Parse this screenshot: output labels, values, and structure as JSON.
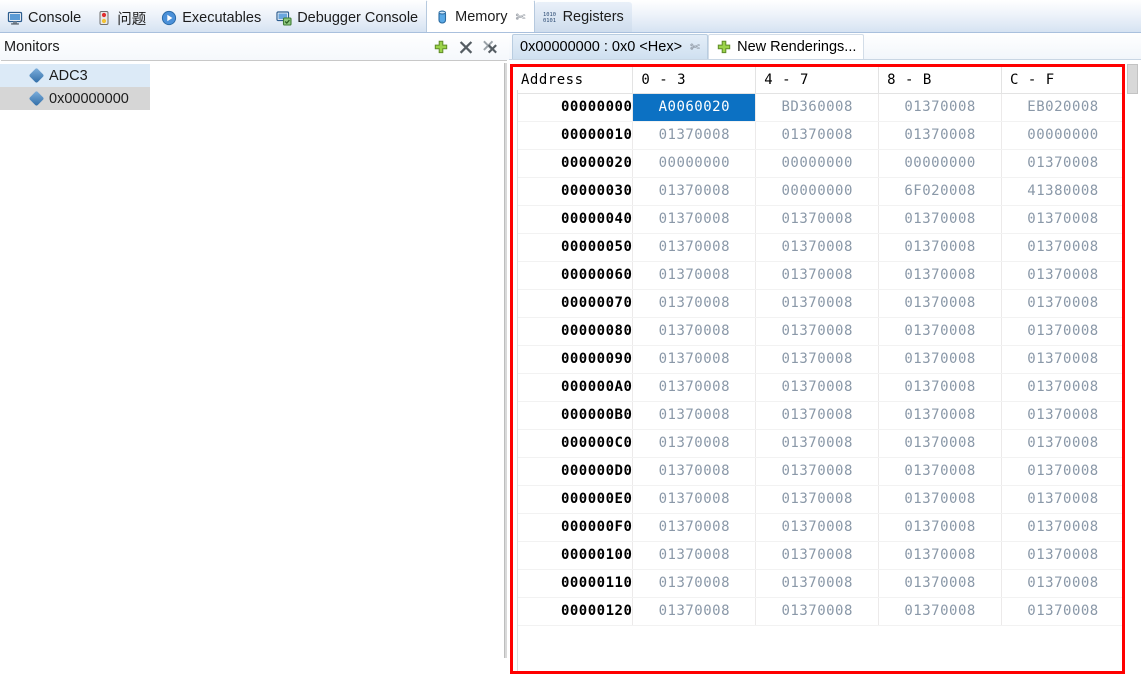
{
  "view_tabs": [
    {
      "label": "Console",
      "icon": "console-icon",
      "active": false
    },
    {
      "label": "问题",
      "icon": "problems-icon",
      "active": false
    },
    {
      "label": "Executables",
      "icon": "executables-icon",
      "active": false
    },
    {
      "label": "Debugger Console",
      "icon": "debugger-console-icon",
      "active": false
    },
    {
      "label": "Memory",
      "icon": "memory-icon",
      "active": true,
      "close": "✄"
    },
    {
      "label": "Registers",
      "icon": "registers-icon",
      "active": false
    }
  ],
  "monitors": {
    "title": "Monitors",
    "toolbar": [
      {
        "name": "add-monitor-button",
        "label": "+"
      },
      {
        "name": "remove-monitor-button",
        "label": "✕"
      },
      {
        "name": "remove-all-monitors-button",
        "label": "✕✕"
      }
    ],
    "items": [
      {
        "label": "ADC3",
        "state": "hover"
      },
      {
        "label": "0x00000000",
        "state": "selected"
      }
    ]
  },
  "renderings": {
    "tabs": [
      {
        "label": "0x00000000 : 0x0 <Hex>",
        "active": true,
        "close": "✄"
      },
      {
        "label": "New Renderings...",
        "active": false,
        "icon": "add-rendering-icon"
      }
    ]
  },
  "memory_table": {
    "columns": [
      "Address",
      "0 - 3",
      "4 - 7",
      "8 - B",
      "C - F"
    ],
    "selected_cell": {
      "row": 0,
      "col": 0
    },
    "rows": [
      {
        "address": "00000000",
        "values": [
          "A0060020",
          "BD360008",
          "01370008",
          "EB020008"
        ]
      },
      {
        "address": "00000010",
        "values": [
          "01370008",
          "01370008",
          "01370008",
          "00000000"
        ]
      },
      {
        "address": "00000020",
        "values": [
          "00000000",
          "00000000",
          "00000000",
          "01370008"
        ]
      },
      {
        "address": "00000030",
        "values": [
          "01370008",
          "00000000",
          "6F020008",
          "41380008"
        ]
      },
      {
        "address": "00000040",
        "values": [
          "01370008",
          "01370008",
          "01370008",
          "01370008"
        ]
      },
      {
        "address": "00000050",
        "values": [
          "01370008",
          "01370008",
          "01370008",
          "01370008"
        ]
      },
      {
        "address": "00000060",
        "values": [
          "01370008",
          "01370008",
          "01370008",
          "01370008"
        ]
      },
      {
        "address": "00000070",
        "values": [
          "01370008",
          "01370008",
          "01370008",
          "01370008"
        ]
      },
      {
        "address": "00000080",
        "values": [
          "01370008",
          "01370008",
          "01370008",
          "01370008"
        ]
      },
      {
        "address": "00000090",
        "values": [
          "01370008",
          "01370008",
          "01370008",
          "01370008"
        ]
      },
      {
        "address": "000000A0",
        "values": [
          "01370008",
          "01370008",
          "01370008",
          "01370008"
        ]
      },
      {
        "address": "000000B0",
        "values": [
          "01370008",
          "01370008",
          "01370008",
          "01370008"
        ]
      },
      {
        "address": "000000C0",
        "values": [
          "01370008",
          "01370008",
          "01370008",
          "01370008"
        ]
      },
      {
        "address": "000000D0",
        "values": [
          "01370008",
          "01370008",
          "01370008",
          "01370008"
        ]
      },
      {
        "address": "000000E0",
        "values": [
          "01370008",
          "01370008",
          "01370008",
          "01370008"
        ]
      },
      {
        "address": "000000F0",
        "values": [
          "01370008",
          "01370008",
          "01370008",
          "01370008"
        ]
      },
      {
        "address": "00000100",
        "values": [
          "01370008",
          "01370008",
          "01370008",
          "01370008"
        ]
      },
      {
        "address": "00000110",
        "values": [
          "01370008",
          "01370008",
          "01370008",
          "01370008"
        ]
      },
      {
        "address": "00000120",
        "values": [
          "01370008",
          "01370008",
          "01370008",
          "01370008"
        ]
      }
    ]
  },
  "colors": {
    "selection_blue": "#0c71c3",
    "annotation_red": "#ff0000",
    "value_gray": "#8a98a8",
    "list_selected_gray": "#d6d6d6",
    "list_hover_blue": "#dceaf7"
  }
}
